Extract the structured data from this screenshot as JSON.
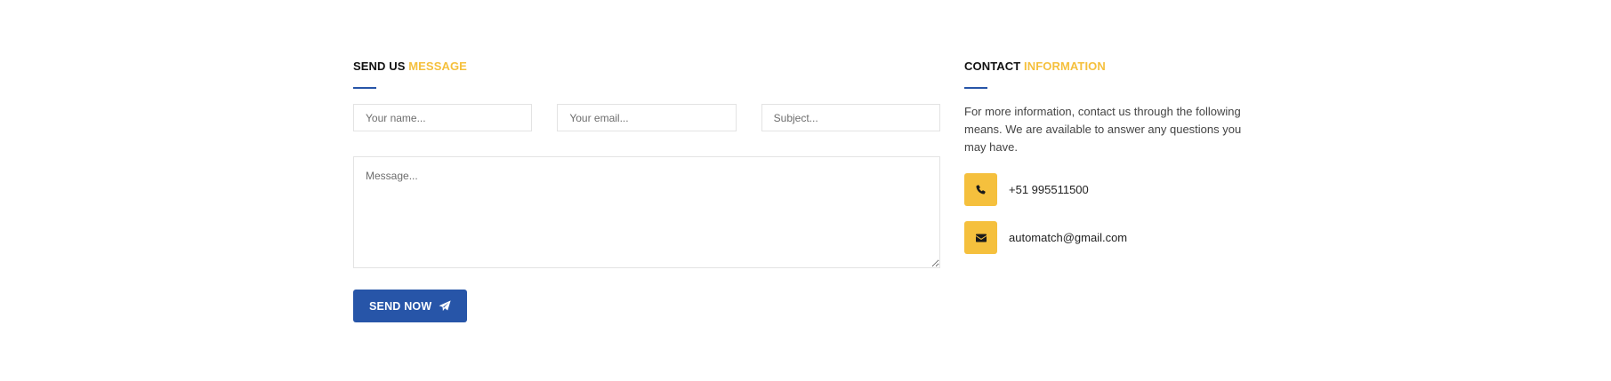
{
  "form": {
    "title_main": "SEND US",
    "title_accent": "MESSAGE",
    "name_placeholder": "Your name...",
    "email_placeholder": "Your email...",
    "subject_placeholder": "Subject...",
    "message_placeholder": "Message...",
    "send_label": "SEND NOW",
    "send_icon": "paper-plane-icon"
  },
  "contact": {
    "title_main": "CONTACT",
    "title_accent": "INFORMATION",
    "description": "For more information, contact us through the following means. We are available to answer any questions you may have.",
    "items": [
      {
        "icon": "phone-icon",
        "text": "+51 995511500"
      },
      {
        "icon": "envelope-icon",
        "text": "automatch@gmail.com"
      }
    ]
  },
  "colors": {
    "accent": "#f5c03d",
    "primary": "#2755a8",
    "background": "#ffffff"
  }
}
